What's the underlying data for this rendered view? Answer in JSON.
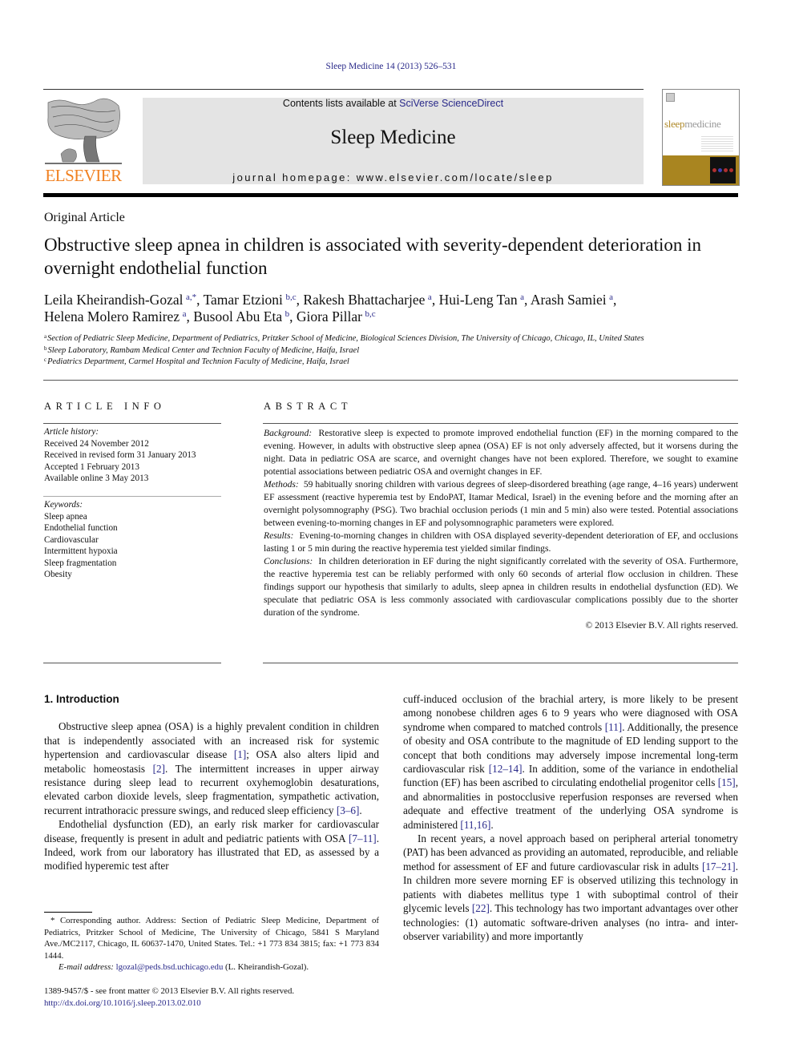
{
  "header": {
    "journal_ref": "Sleep Medicine 14 (2013) 526–531",
    "contents_prefix": "Contents lists available at ",
    "contents_link": "SciVerse ScienceDirect",
    "journal_title": "Sleep Medicine",
    "homepage": "journal homepage: www.elsevier.com/locate/sleep",
    "publisher": "ELSEVIER",
    "cover_title_a": "sleep",
    "cover_title_b": "medicine"
  },
  "article": {
    "type": "Original Article",
    "title": "Obstructive sleep apnea in children is associated with severity-dependent deterioration in overnight endothelial function",
    "authors": [
      {
        "name": "Leila Kheirandish-Gozal",
        "sup": "a,*",
        "sep": ", "
      },
      {
        "name": "Tamar Etzioni",
        "sup": "b,c",
        "sep": ", "
      },
      {
        "name": "Rakesh Bhattacharjee",
        "sup": "a",
        "sep": ", "
      },
      {
        "name": "Hui-Leng Tan",
        "sup": "a",
        "sep": ", "
      },
      {
        "name": "Arash Samiei",
        "sup": "a",
        "sep": ","
      },
      {
        "name": "Helena Molero Ramirez",
        "sup": "a",
        "sep": ", "
      },
      {
        "name": "Busool Abu Eta",
        "sup": "b",
        "sep": ", "
      },
      {
        "name": "Giora Pillar",
        "sup": "b,c",
        "sep": ""
      }
    ],
    "affiliations": [
      {
        "key": "a",
        "text": "Section of Pediatric Sleep Medicine, Department of Pediatrics, Pritzker School of Medicine, Biological Sciences Division, The University of Chicago, Chicago, IL, United States"
      },
      {
        "key": "b",
        "text": "Sleep Laboratory, Rambam Medical Center and Technion Faculty of Medicine, Haifa, Israel"
      },
      {
        "key": "c",
        "text": "Pediatrics Department, Carmel Hospital and Technion Faculty of Medicine, Haifa, Israel"
      }
    ]
  },
  "info": {
    "heading": "ARTICLE INFO",
    "history_label": "Article history:",
    "history": [
      "Received 24 November 2012",
      "Received in revised form 31 January 2013",
      "Accepted 1 February 2013",
      "Available online 3 May 2013"
    ],
    "keywords_label": "Keywords:",
    "keywords": [
      "Sleep apnea",
      "Endothelial function",
      "Cardiovascular",
      "Intermittent hypoxia",
      "Sleep fragmentation",
      "Obesity"
    ]
  },
  "abstract": {
    "heading": "ABSTRACT",
    "sections": [
      {
        "label": "Background:",
        "text": "Restorative sleep is expected to promote improved endothelial function (EF) in the morning compared to the evening. However, in adults with obstructive sleep apnea (OSA) EF is not only adversely affected, but it worsens during the night. Data in pediatric OSA are scarce, and overnight changes have not been explored. Therefore, we sought to examine potential associations between pediatric OSA and overnight changes in EF."
      },
      {
        "label": "Methods:",
        "text": "59 habitually snoring children with various degrees of sleep-disordered breathing (age range, 4–16 years) underwent EF assessment (reactive hyperemia test by EndoPAT, Itamar Medical, Israel) in the evening before and the morning after an overnight polysomnography (PSG). Two brachial occlusion periods (1 min and 5 min) also were tested. Potential associations between evening-to-morning changes in EF and polysomnographic parameters were explored."
      },
      {
        "label": "Results:",
        "text": "Evening-to-morning changes in children with OSA displayed severity-dependent deterioration of EF, and occlusions lasting 1 or 5 min during the reactive hyperemia test yielded similar findings."
      },
      {
        "label": "Conclusions:",
        "text": "In children deterioration in EF during the night significantly correlated with the severity of OSA. Furthermore, the reactive hyperemia test can be reliably performed with only 60 seconds of arterial flow occlusion in children. These findings support our hypothesis that similarly to adults, sleep apnea in children results in endothelial dysfunction (ED). We speculate that pediatric OSA is less commonly associated with cardiovascular complications possibly due to the shorter duration of the syndrome."
      }
    ],
    "copyright": "© 2013 Elsevier B.V. All rights reserved."
  },
  "body": {
    "section_heading": "1. Introduction",
    "col1": [
      [
        {
          "t": "Obstructive sleep apnea (OSA) is a highly prevalent condition in children that is independently associated with an increased risk for systemic hypertension and cardiovascular disease "
        },
        {
          "r": "[1]"
        },
        {
          "t": "; OSA also alters lipid and metabolic homeostasis "
        },
        {
          "r": "[2]"
        },
        {
          "t": ". The intermittent increases in upper airway resistance during sleep lead to recurrent oxyhemoglobin desaturations, elevated carbon dioxide levels, sleep fragmentation, sympathetic activation, recurrent intrathoracic pressure swings, and reduced sleep efficiency "
        },
        {
          "r": "[3–6]"
        },
        {
          "t": "."
        }
      ],
      [
        {
          "t": "Endothelial dysfunction (ED), an early risk marker for cardiovascular disease, frequently is present in adult and pediatric patients with OSA "
        },
        {
          "r": "[7–11]"
        },
        {
          "t": ". Indeed, work from our laboratory has illustrated that ED, as assessed by a modified hyperemic test after"
        }
      ]
    ],
    "col2": [
      [
        {
          "t": "cuff-induced occlusion of the brachial artery, is more likely to be present among nonobese children ages 6 to 9 years who were diagnosed with OSA syndrome when compared to matched controls "
        },
        {
          "r": "[11]"
        },
        {
          "t": ". Additionally, the presence of obesity and OSA contribute to the magnitude of ED lending support to the concept that both conditions may adversely impose incremental long-term cardiovascular risk "
        },
        {
          "r": "[12–14]"
        },
        {
          "t": ". In addition, some of the variance in endothelial function (EF) has been ascribed to circulating endothelial progenitor cells "
        },
        {
          "r": "[15]"
        },
        {
          "t": ", and abnormalities in postocclusive reperfusion responses are reversed when adequate and effective treatment of the underlying OSA syndrome is administered "
        },
        {
          "r": "[11,16]"
        },
        {
          "t": "."
        }
      ],
      [
        {
          "t": "In recent years, a novel approach based on peripheral arterial tonometry (PAT) has been advanced as providing an automated, reproducible, and reliable method for assessment of EF and future cardiovascular risk in adults "
        },
        {
          "r": "[17–21]"
        },
        {
          "t": ". In children more severe morning EF is observed utilizing this technology in patients with diabetes mellitus type 1 with suboptimal control of their glycemic levels "
        },
        {
          "r": "[22]"
        },
        {
          "t": ". This technology has two important advantages over other technologies: (1) automatic software-driven analyses (no intra- and inter-observer variability) and more importantly"
        }
      ]
    ]
  },
  "footnote": {
    "corresponding": "* Corresponding author. Address: Section of Pediatric Sleep Medicine, Department of Pediatrics, Pritzker School of Medicine, The University of Chicago, 5841 S Maryland Ave./MC2117, Chicago, IL 60637-1470, United States. Tel.: +1 773 834 3815; fax: +1 773 834 1444.",
    "email_label": "E-mail address:",
    "email": "lgozal@peds.bsd.uchicago.edu",
    "email_suffix": " (L. Kheirandish-Gozal).",
    "front_matter": "1389-9457/$ - see front matter © 2013 Elsevier B.V. All rights reserved.",
    "doi": "http://dx.doi.org/10.1016/j.sleep.2013.02.010"
  },
  "colors": {
    "link": "#2a2a8a",
    "elsevier_orange": "#f08020",
    "cover_gold": "#a98520",
    "banner_gray": "#e4e4e4"
  }
}
